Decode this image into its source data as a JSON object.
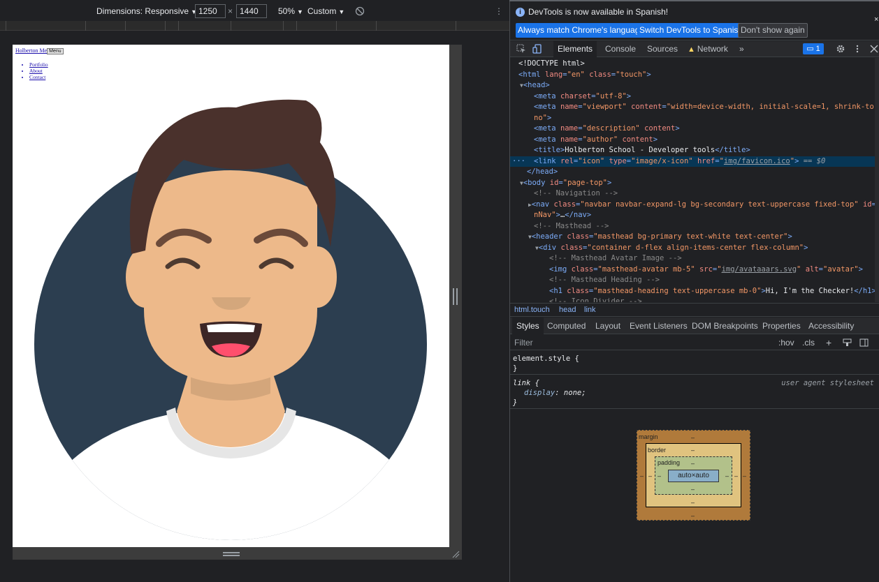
{
  "device_toolbar": {
    "dimensions_label": "Dimensions: Responsive",
    "width": "1250",
    "times": "×",
    "height": "1440",
    "zoom": "50%",
    "throttle": "Custom",
    "more": "⋮"
  },
  "page": {
    "brand": "Holberton Me",
    "menu_button": "Menu",
    "links": [
      "Portfolio",
      "About",
      "Contact"
    ],
    "avatar_colors": {
      "background_circle": "#2c3e50",
      "hair": "#4a312c",
      "skin": "#edb98a",
      "shirt": "#ffffff",
      "tongue": "#ff4f6d"
    }
  },
  "devtools": {
    "infobar": {
      "message": "DevTools is now available in Spanish!",
      "btn_match": "Always match Chrome's language",
      "btn_switch": "Switch DevTools to Spanish",
      "btn_dismiss": "Don't show again",
      "close": "×"
    },
    "tabs": {
      "elements": "Elements",
      "console": "Console",
      "sources": "Sources",
      "network": "Network",
      "more": "»",
      "issues_count": "1"
    },
    "dom": [
      "<!DOCTYPE html>",
      "<html lang=\"en\" class=\"touch\">",
      "<head>",
      "<meta charset=\"utf-8\">",
      "<meta name=\"viewport\" content=\"width=device-width, initial-scale=1, shrink-to-fit=",
      "no\">",
      "<meta name=\"description\" content>",
      "<meta name=\"author\" content>",
      "<title>Holberton School - Developer tools</title>",
      "<link rel=\"icon\" type=\"image/x-icon\" href=\"img/favicon.ico\"> == $0",
      "</head>",
      "<body id=\"page-top\">",
      "<!-- Navigation -->",
      "<nav class=\"navbar navbar-expand-lg bg-secondary text-uppercase fixed-top\" id=\"mai",
      "nNav\">…</nav>",
      "<!-- Masthead -->",
      "<header class=\"masthead bg-primary text-white text-center\">",
      "<div class=\"container d-flex align-items-center flex-column\">",
      "<!-- Masthead Avatar Image -->",
      "<img class=\"masthead-avatar mb-5\" src=\"img/avataaars.svg\" alt=\"avatar\">",
      "<!-- Masthead Heading -->",
      "<h1 class=\"masthead-heading text-uppercase mb-0\">Hi, I'm the Checker!</h1>",
      "<!-- Icon Divider -->"
    ],
    "breadcrumbs": [
      "html.touch",
      "head",
      "link"
    ],
    "style_tabs": [
      "Styles",
      "Computed",
      "Layout",
      "Event Listeners",
      "DOM Breakpoints",
      "Properties",
      "Accessibility"
    ],
    "filter": {
      "placeholder": "Filter",
      "hov": ":hov",
      "cls": ".cls",
      "plus": "+"
    },
    "rules": {
      "element_style": "element.style {",
      "close_brace": "}",
      "link_selector": "link {",
      "link_source": "user agent stylesheet",
      "link_prop": "display",
      "link_val": "none;"
    },
    "box_model": {
      "margin": "margin",
      "border": "border",
      "padding": "padding",
      "content": "auto×auto",
      "dash": "–"
    }
  }
}
